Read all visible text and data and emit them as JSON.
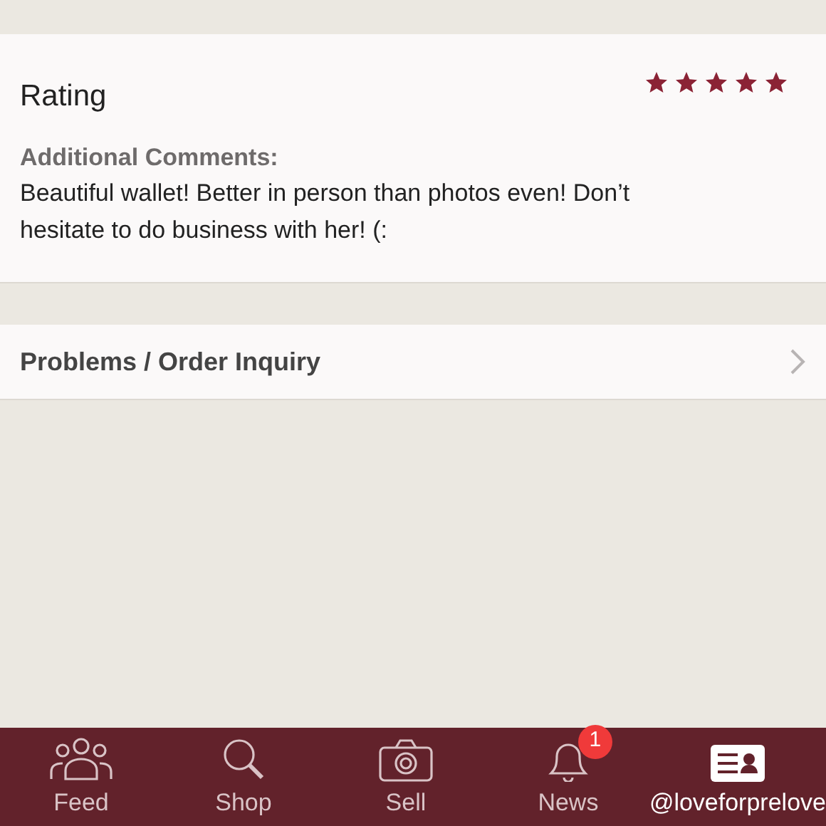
{
  "rating": {
    "title": "Rating",
    "stars": 5
  },
  "comments": {
    "label": "Additional Comments:",
    "text": "Beautiful wallet! Better in person than photos even! Don’t hesitate to do business with her! (:"
  },
  "problems_row": {
    "label": "Problems / Order Inquiry"
  },
  "tab_bar": [
    {
      "kind": "feed",
      "label": "Feed",
      "selected": false
    },
    {
      "kind": "shop",
      "label": "Shop",
      "selected": false
    },
    {
      "kind": "sell",
      "label": "Sell",
      "selected": false
    },
    {
      "kind": "news",
      "label": "News",
      "selected": false,
      "badge": "1"
    },
    {
      "kind": "profile",
      "label": "@loveforprelove",
      "selected": true
    }
  ]
}
